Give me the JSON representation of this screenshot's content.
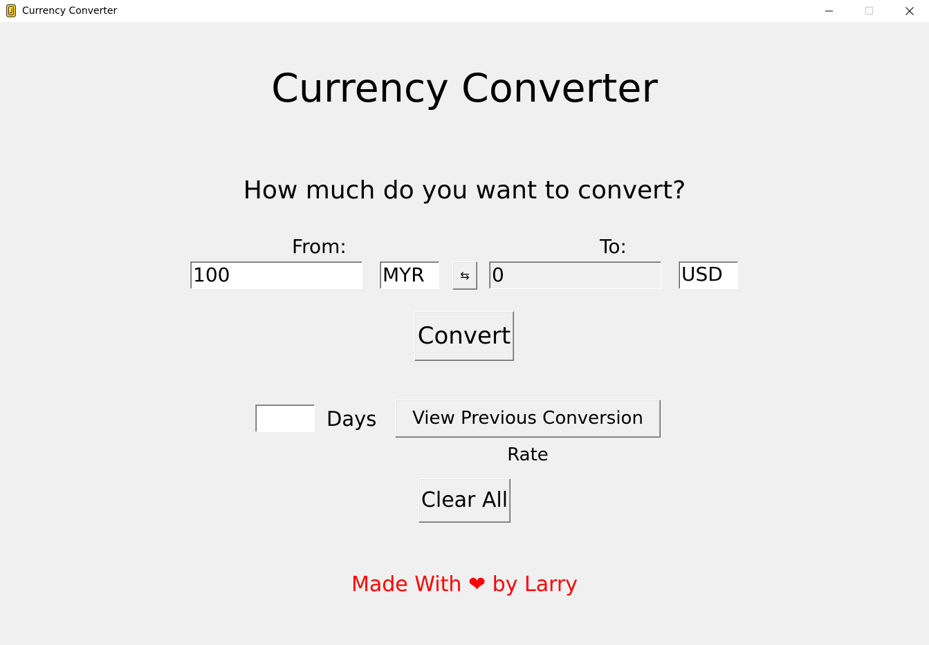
{
  "window": {
    "title": "Currency Converter",
    "app_icon": "coin-icon",
    "controls": [
      "minimize-icon",
      "maximize-icon",
      "close-icon"
    ]
  },
  "main": {
    "heading": "Currency Converter",
    "question": "How much do you want to convert?",
    "from_label": "From:",
    "to_label": "To:",
    "from_amount": "100",
    "from_currency": "MYR",
    "swap_symbol": "⇆",
    "to_amount": "0",
    "to_currency": "USD",
    "convert_label": "Convert",
    "days_value": "",
    "days_label": "Days",
    "history_label": "View Previous Conversion Rate",
    "clear_label": "Clear All",
    "footer_prefix": "Made With",
    "footer_heart": "❤",
    "footer_suffix": "by Larry"
  },
  "colors": {
    "background": "#f0f0f0",
    "footer": "#ff0000"
  }
}
